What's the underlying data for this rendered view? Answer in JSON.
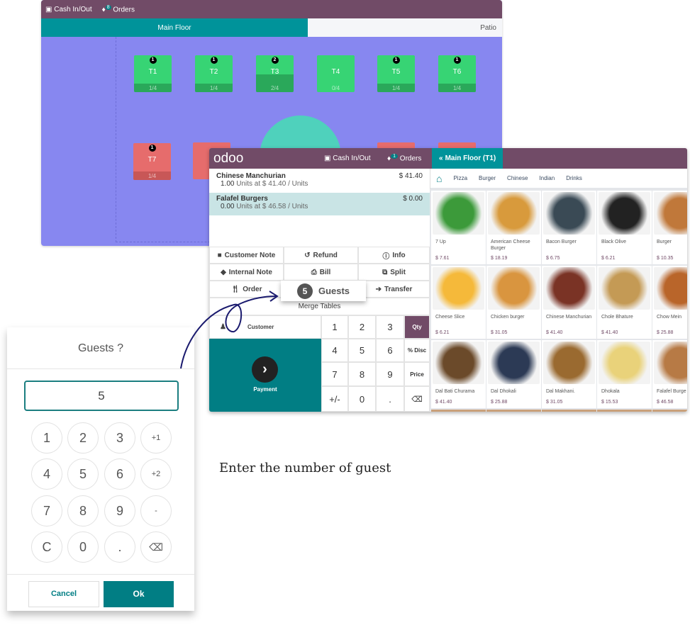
{
  "floor_window": {
    "header": {
      "cash_label": "Cash In/Out",
      "orders_label": "Orders",
      "orders_count": "8"
    },
    "tabs": [
      {
        "label": "Main Floor",
        "active": true
      },
      {
        "label": "Patio",
        "active": false
      }
    ],
    "tables": [
      {
        "name": "T1",
        "badge": "1",
        "seats": "1/4",
        "color": "#37d474"
      },
      {
        "name": "T2",
        "badge": "1",
        "seats": "1/4",
        "color": "#37d474"
      },
      {
        "name": "T3",
        "badge": "2",
        "seats": "2/4",
        "color": "#37d474"
      },
      {
        "name": "T4",
        "badge": "",
        "seats": "0/4",
        "color": "#37d474"
      },
      {
        "name": "T5",
        "badge": "1",
        "seats": "1/4",
        "color": "#37d474"
      },
      {
        "name": "T6",
        "badge": "1",
        "seats": "1/4",
        "color": "#37d474"
      },
      {
        "name": "T7",
        "badge": "1",
        "seats": "1/4",
        "color": "#e66c6c"
      }
    ]
  },
  "pos": {
    "header": {
      "logo": "odoo",
      "cash_label": "Cash In/Out",
      "orders_label": "Orders",
      "orders_count": "1",
      "floor_button": "Main Floor (T1)"
    },
    "order_lines": [
      {
        "name": "Chinese Manchurian",
        "price": "$ 41.40",
        "qty": "1.00",
        "detail": "Units at $ 41.40 / Units",
        "selected": false
      },
      {
        "name": "Falafel Burgers",
        "price": "$ 0.00",
        "qty": "0.00",
        "detail": "Units at $ 46.58 / Units",
        "selected": true
      }
    ],
    "actions": {
      "customer_note": "Customer Note",
      "refund": "Refund",
      "info": "Info",
      "internal_note": "Internal Note",
      "bill": "Bill",
      "split": "Split",
      "order": "Order",
      "guests_count": "5",
      "guests": "Guests",
      "transfer": "Transfer",
      "merge_tables": "Merge Tables"
    },
    "customer_label": "Customer",
    "payment_label": "Payment",
    "keypad": {
      "keys": [
        "1",
        "2",
        "3",
        "4",
        "5",
        "6",
        "7",
        "8",
        "9",
        "+/-",
        "0",
        "."
      ],
      "modes": [
        "Qty",
        "% Disc",
        "Price"
      ],
      "active_mode": "Qty"
    },
    "categories": [
      "Pizza",
      "Burger",
      "Chinese",
      "Indian",
      "Drinks"
    ],
    "products": [
      {
        "name": "7 Up",
        "price": "$ 7.61",
        "color": "#3c9a3a"
      },
      {
        "name": "American Cheese Burger",
        "price": "$ 18.19",
        "color": "#d89a3c"
      },
      {
        "name": "Bacon Burger",
        "price": "$ 6.75",
        "color": "#3a4a55"
      },
      {
        "name": "Black Olive",
        "price": "$ 6.21",
        "color": "#222222"
      },
      {
        "name": "Burger",
        "price": "$ 10.35",
        "color": "#c0783a"
      },
      {
        "name": "Cheese Slice",
        "price": "$ 6.21",
        "color": "#f5b93a"
      },
      {
        "name": "Chicken burger",
        "price": "$ 31.05",
        "color": "#d9953f"
      },
      {
        "name": "Chinese Manchurian",
        "price": "$ 41.40",
        "color": "#7a3325"
      },
      {
        "name": "Chole Bhature",
        "price": "$ 41.40",
        "color": "#c49a55"
      },
      {
        "name": "Chow Mein",
        "price": "$ 25.88",
        "color": "#b9652a"
      },
      {
        "name": "Dal Bati Churama",
        "price": "$ 41.40",
        "color": "#6b4a2a"
      },
      {
        "name": "Dal Dhokali",
        "price": "$ 25.88",
        "color": "#2c3a55"
      },
      {
        "name": "Dal Makhani.",
        "price": "$ 31.05",
        "color": "#9a6a30"
      },
      {
        "name": "Dhokala",
        "price": "$ 15.53",
        "color": "#e9d27a"
      },
      {
        "name": "Falafel Burge",
        "price": "$ 46.58",
        "color": "#b77a45"
      }
    ]
  },
  "guests_dialog": {
    "title": "Guests ?",
    "value": "5",
    "keys": [
      "1",
      "2",
      "3",
      "+1",
      "4",
      "5",
      "6",
      "+2",
      "7",
      "8",
      "9",
      "-",
      "C",
      "0",
      "."
    ],
    "cancel": "Cancel",
    "ok": "Ok"
  },
  "annotation": "Enter the number of guest",
  "colors": {
    "purple": "#714b67",
    "teal": "#017e84",
    "floor": "#8787f0"
  }
}
